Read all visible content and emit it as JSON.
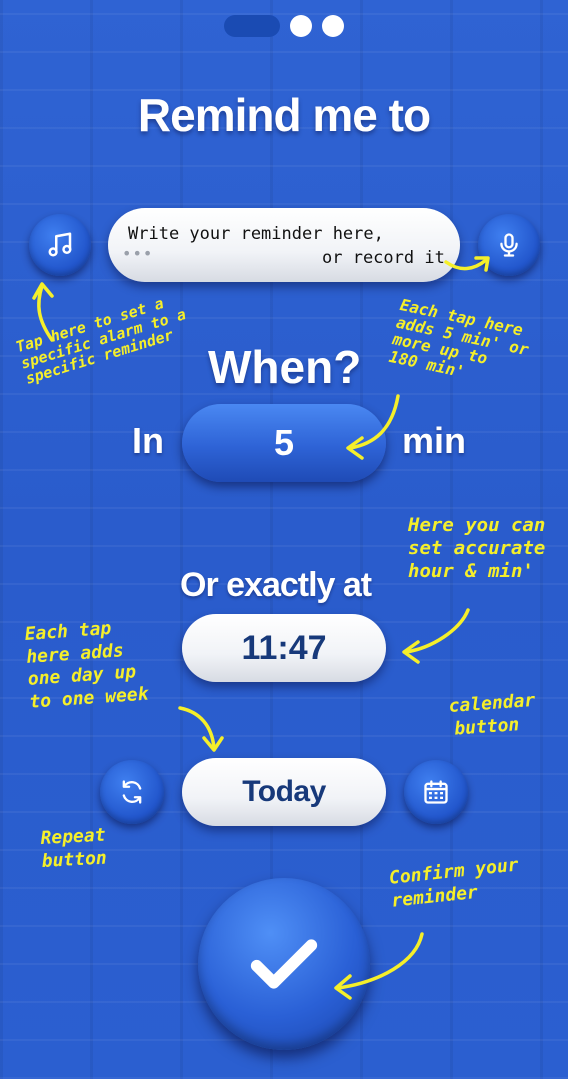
{
  "header": {
    "title": "Remind me to"
  },
  "reminder": {
    "line1": "Write your reminder here,",
    "line2": "or record it",
    "ellipsis": "•••"
  },
  "when": {
    "title": "When?",
    "in_label": "In",
    "minutes": "5",
    "unit": "min"
  },
  "exact": {
    "title": "Or exactly at",
    "time": "11:47",
    "day": "Today"
  },
  "notes": {
    "alarm": [
      "Tap here to set a",
      "specific alarm to a",
      "specific reminder"
    ],
    "minutes": [
      "Each tap here",
      "adds 5 min' or",
      "more up to",
      "180 min'"
    ],
    "hour": [
      "Here you can",
      "set accurate",
      "hour & min'"
    ],
    "day": [
      "Each tap",
      "here adds",
      "one day up",
      "to one week"
    ],
    "calendar": [
      "calendar",
      "button"
    ],
    "repeat": [
      "Repeat",
      "button"
    ],
    "confirm": [
      "Confirm your",
      "reminder"
    ]
  },
  "colors": {
    "background": "#2b5fd0",
    "annotation": "#f5ef2a",
    "pill_text": "#17397a"
  },
  "icons": [
    "music-note-icon",
    "microphone-icon",
    "repeat-icon",
    "calendar-icon",
    "checkmark-icon"
  ]
}
